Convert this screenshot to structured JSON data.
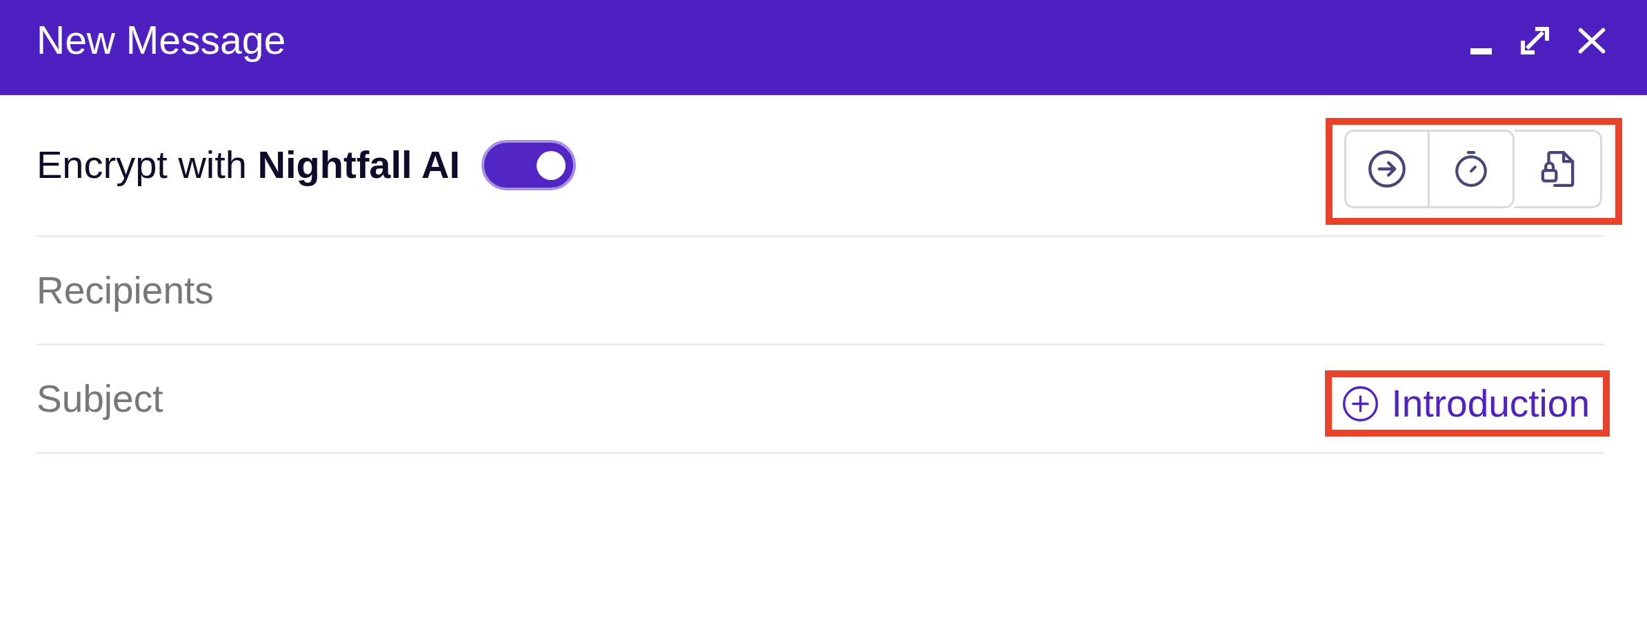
{
  "window": {
    "title": "New Message"
  },
  "encryption": {
    "label": "Encrypt with **Nightfall AI**",
    "on": true
  },
  "toolbar": {
    "highlighted": true
  },
  "recipients": {
    "placeholder": "Recipients"
  },
  "subject": {
    "placeholder": "Subject",
    "template_button": {
      "label": "Introduction",
      "highlighted": true
    }
  }
}
